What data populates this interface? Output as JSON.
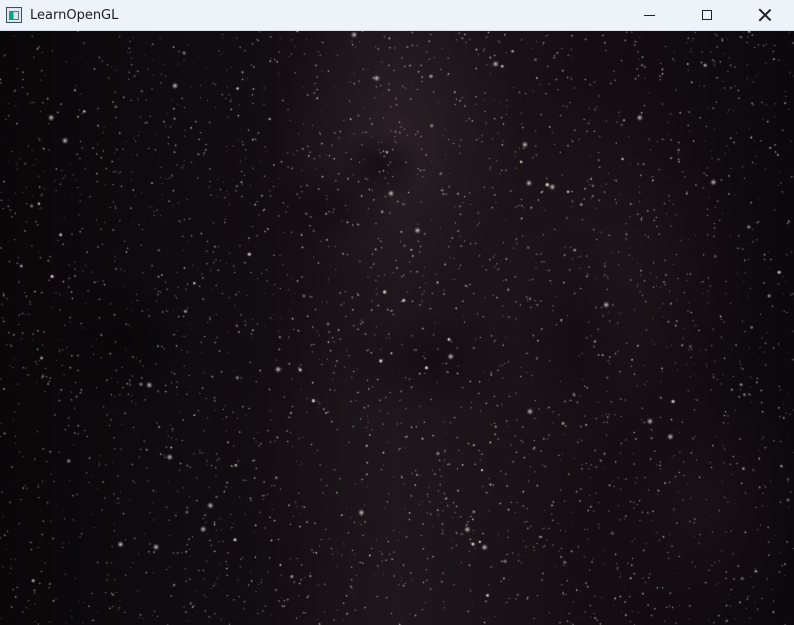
{
  "window": {
    "title": "LearnOpenGL",
    "app_icon": "application-window-icon",
    "controls": {
      "minimize_icon": "minimize-icon",
      "maximize_icon": "maximize-icon",
      "close_icon": "close-icon"
    }
  },
  "scene": {
    "background_color": "#0b070a",
    "nebula_color": "#2a1f27",
    "star_color": "#f3efe7"
  }
}
